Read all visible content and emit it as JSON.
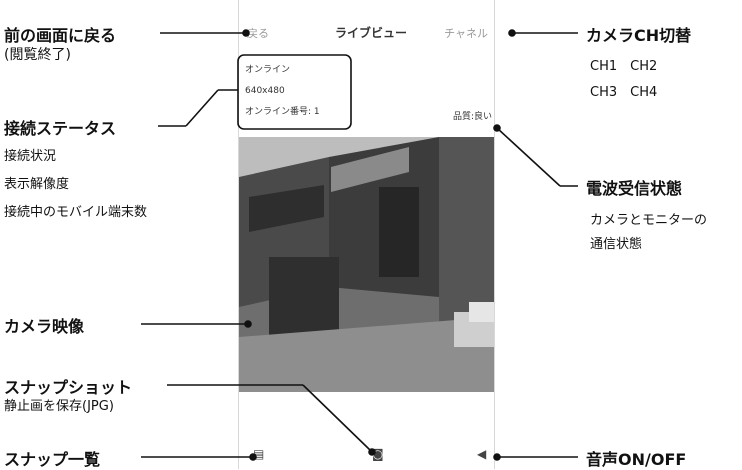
{
  "phone": {
    "nav": {
      "back_label": "戻る",
      "title": "ライブビュー",
      "channel_label": "チャネル"
    },
    "status": {
      "line1": "オンライン",
      "line2": "640x480",
      "line3": "オンライン番号: 1"
    },
    "quality": "品質:良い",
    "toolbar": {
      "snapshot_list_icon": "gallery-icon",
      "camera_icon": "camera-icon",
      "speaker_icon": "speaker-icon"
    }
  },
  "annotations": {
    "back": {
      "title": "前の画面に戻る",
      "sub": "(閲覧終了)"
    },
    "connection": {
      "title": "接続ステータス",
      "items": [
        "接続状況",
        "表示解像度",
        "接続中のモバイル端末数"
      ]
    },
    "camera_video": {
      "title": "カメラ映像"
    },
    "snapshot": {
      "title": "スナップショット",
      "sub": "静止画を保存(JPG)"
    },
    "snapshot_list": {
      "title": "スナップ一覧"
    },
    "camera_ch": {
      "title": "カメラCH切替",
      "items": [
        "CH1　CH2",
        "CH3　CH4"
      ]
    },
    "signal": {
      "title": "電波受信状態",
      "items": [
        "カメラとモニターの",
        "通信状態"
      ]
    },
    "audio": {
      "title": "音声ON/OFF"
    }
  },
  "colors": {
    "line": "#111111",
    "frame": "#d8d8d8"
  }
}
